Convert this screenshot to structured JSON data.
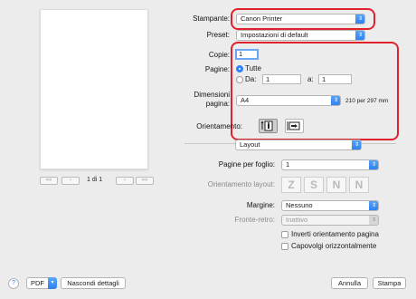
{
  "printer": {
    "label": "Stampante:",
    "value": "Canon Printer"
  },
  "preset": {
    "label": "Preset:",
    "value": "Impostazioni di default"
  },
  "copies": {
    "label": "Copie:",
    "value": "1"
  },
  "pages": {
    "label": "Pagine:",
    "all_label": "Tutte",
    "from_label": "Da:",
    "from_value": "1",
    "to_label": "a:",
    "to_value": "1"
  },
  "paper_size": {
    "label_line1": "Dimensioni",
    "label_line2": "pagina:",
    "value": "A4",
    "dimensions": "210 per 297 mm"
  },
  "orientation": {
    "label": "Orientamento:"
  },
  "section_menu": {
    "value": "Layout"
  },
  "pages_per_sheet": {
    "label": "Pagine per foglio:",
    "value": "1"
  },
  "layout_direction": {
    "label": "Orientamento layout:",
    "glyphs": [
      "Z",
      "S",
      "N",
      "N"
    ]
  },
  "border": {
    "label": "Margine:",
    "value": "Nessuno"
  },
  "two_sided": {
    "label": "Fronte-retro:",
    "value": "Inattivo"
  },
  "options": {
    "reverse_orientation": "Inverti orientamento pagina",
    "flip_horizontal": "Capovolgi orizzontalmente"
  },
  "preview_nav": {
    "first": "««",
    "prev": "‹",
    "page_indicator": "1 di 1",
    "next": "›",
    "last": "»»"
  },
  "footer": {
    "help": "?",
    "pdf": "PDF",
    "hide_details": "Nascondi dettagli",
    "cancel": "Annulla",
    "print": "Stampa"
  },
  "colors": {
    "accent": "#2f84f3",
    "highlight": "#e0222d"
  }
}
